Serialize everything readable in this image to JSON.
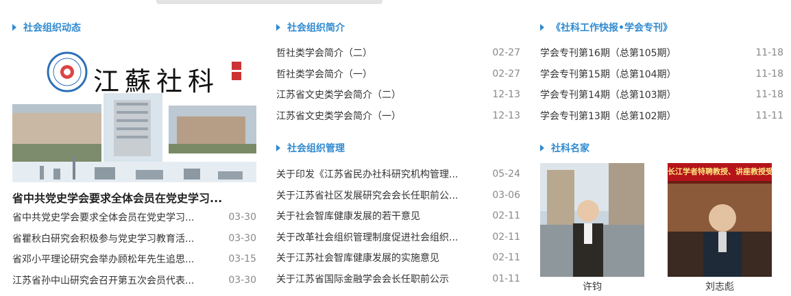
{
  "col1": {
    "title": "社会组织动态",
    "banner": {
      "logo_text": "江蘇社科"
    },
    "headline": "省中共党史学会要求全体会员在党史学习...",
    "items": [
      {
        "title": "省中共党史学会要求全体会员在党史学习...",
        "date": "03-30"
      },
      {
        "title": "省瞿秋白研究会积极参与党史学习教育活...",
        "date": "03-30"
      },
      {
        "title": "省邓小平理论研究会举办顾松年先生追思...",
        "date": "03-15"
      },
      {
        "title": "江苏省孙中山研究会召开第五次会员代表...",
        "date": "03-30"
      }
    ]
  },
  "col2": {
    "intro": {
      "title": "社会组织简介",
      "items": [
        {
          "title": "哲社类学会简介（二）",
          "date": "02-27"
        },
        {
          "title": "哲社类学会简介（一）",
          "date": "02-27"
        },
        {
          "title": "江苏省文史类学会简介（二）",
          "date": "12-13"
        },
        {
          "title": "江苏省文史类学会简介（一）",
          "date": "12-13"
        }
      ]
    },
    "manage": {
      "title": "社会组织管理",
      "items": [
        {
          "title": "关于印发《江苏省民办社科研究机构管理...",
          "date": "05-24"
        },
        {
          "title": "关于江苏省社区发展研究会会长任职前公...",
          "date": "03-06"
        },
        {
          "title": "关于社会智库健康发展的若干意见",
          "date": "02-11"
        },
        {
          "title": "关于改革社会组织管理制度促进社会组织...",
          "date": "02-11"
        },
        {
          "title": "关于江苏社会智库健康发展的实施意见",
          "date": "02-11"
        },
        {
          "title": "关于江苏省国际金融学会会长任职前公示",
          "date": "01-11"
        }
      ]
    }
  },
  "col3": {
    "bulletin": {
      "title": "《社科工作快报•学会专刊》",
      "items": [
        {
          "title": "学会专刊第16期（总第105期）",
          "date": "11-18"
        },
        {
          "title": "学会专刊第15期（总第104期）",
          "date": "11-18"
        },
        {
          "title": "学会专刊第14期（总第103期）",
          "date": "11-18"
        },
        {
          "title": "学会专刊第13期（总第102期）",
          "date": "11-11"
        }
      ]
    },
    "experts": {
      "title": "社科名家",
      "people": [
        {
          "name": "许钧"
        },
        {
          "name": "刘志彪",
          "photo_banner_text": "长江学者特聘教授、讲座教授受聘"
        }
      ]
    }
  },
  "colors": {
    "accent": "#2f8ad0",
    "date": "#888888",
    "text": "#333333"
  }
}
